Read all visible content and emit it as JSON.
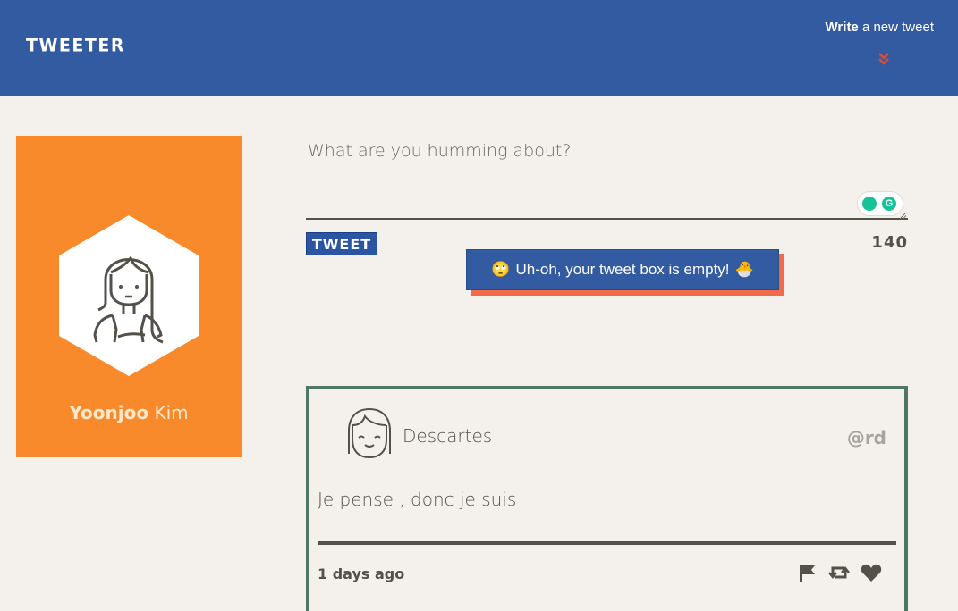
{
  "nav": {
    "brand": "TWEETER",
    "compose_bold": "Write",
    "compose_rest": " a new tweet",
    "icon": "double-chevron-down-icon"
  },
  "profile": {
    "first_name": "Yoonjoo",
    "last_name": " Kim",
    "avatar_icon": "girl-avatar-icon",
    "card_color": "#f98a2c"
  },
  "composer": {
    "placeholder": "What are you humming about?",
    "value": "",
    "button_label": "TWEET",
    "counter": "140",
    "error_emoji": "🙄",
    "error_text": "Uh-oh, your tweet box is empty!",
    "error_emoji_end": "🐣",
    "grammarly_letter": "G"
  },
  "tweet": {
    "name": "Descartes",
    "handle": "@rd",
    "content": "Je pense , donc je suis",
    "time": "1 days ago",
    "avatar_icon": "smiling-girl-avatar-icon",
    "actions": [
      "flag-icon",
      "retweet-icon",
      "heart-icon"
    ]
  },
  "colors": {
    "nav": "#335ba1",
    "background": "#f4f1ec",
    "tweet_border": "#4f7767",
    "error_shadow": "#f06a4b",
    "chevron": "#e8492f"
  }
}
